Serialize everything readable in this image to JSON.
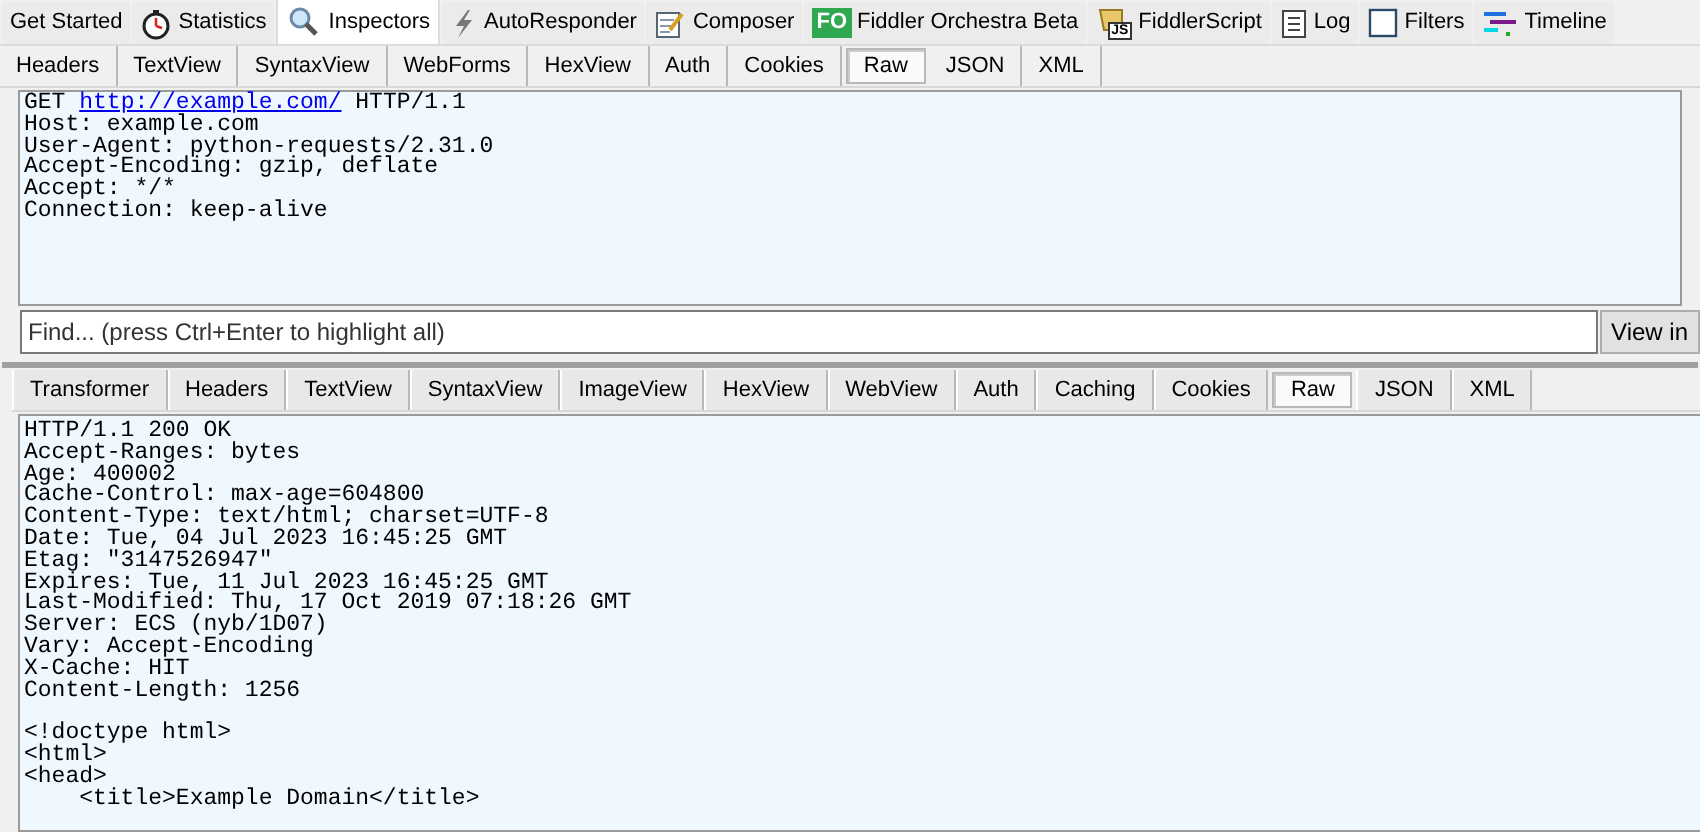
{
  "main_tabs": [
    {
      "kind": "plain",
      "label": "Get Started",
      "selected": false
    },
    {
      "kind": "stopwatch",
      "label": "Statistics",
      "selected": false
    },
    {
      "kind": "magnifier",
      "label": "Inspectors",
      "selected": true
    },
    {
      "kind": "lightning",
      "label": "AutoResponder",
      "selected": false
    },
    {
      "kind": "notepad",
      "label": "Composer",
      "selected": false
    },
    {
      "kind": "badge",
      "badge": "FO",
      "label": "Fiddler Orchestra Beta",
      "selected": false
    },
    {
      "kind": "scroll",
      "badge": "JS",
      "label": "FiddlerScript",
      "selected": false
    },
    {
      "kind": "document",
      "label": "Log",
      "selected": false
    },
    {
      "kind": "checkbox",
      "label": "Filters",
      "selected": false
    },
    {
      "kind": "timeline",
      "label": "Timeline",
      "selected": false
    }
  ],
  "request": {
    "tabs": [
      {
        "label": "Headers",
        "selected": false
      },
      {
        "label": "TextView",
        "selected": false
      },
      {
        "label": "SyntaxView",
        "selected": false
      },
      {
        "label": "WebForms",
        "selected": false
      },
      {
        "label": "HexView",
        "selected": false
      },
      {
        "label": "Auth",
        "selected": false
      },
      {
        "label": "Cookies",
        "selected": false
      },
      {
        "label": "Raw",
        "selected": true
      },
      {
        "label": "JSON",
        "selected": false
      },
      {
        "label": "XML",
        "selected": false
      }
    ],
    "request_line": {
      "method": "GET",
      "url": "http://example.com/",
      "version": "HTTP/1.1"
    },
    "headers": [
      "Host: example.com",
      "User-Agent: python-requests/2.31.0",
      "Accept-Encoding: gzip, deflate",
      "Accept: */*",
      "Connection: keep-alive"
    ],
    "find": {
      "placeholder": "Find... (press Ctrl+Enter to highlight all)"
    },
    "view_button": "View in"
  },
  "response": {
    "tabs": [
      {
        "label": "Transformer",
        "selected": false
      },
      {
        "label": "Headers",
        "selected": false
      },
      {
        "label": "TextView",
        "selected": false
      },
      {
        "label": "SyntaxView",
        "selected": false
      },
      {
        "label": "ImageView",
        "selected": false
      },
      {
        "label": "HexView",
        "selected": false
      },
      {
        "label": "WebView",
        "selected": false
      },
      {
        "label": "Auth",
        "selected": false
      },
      {
        "label": "Caching",
        "selected": false
      },
      {
        "label": "Cookies",
        "selected": false
      },
      {
        "label": "Raw",
        "selected": true
      },
      {
        "label": "JSON",
        "selected": false
      },
      {
        "label": "XML",
        "selected": false
      }
    ],
    "headers": [
      "HTTP/1.1 200 OK",
      "Accept-Ranges: bytes",
      "Age: 400002",
      "Cache-Control: max-age=604800",
      "Content-Type: text/html; charset=UTF-8",
      "Date: Tue, 04 Jul 2023 16:45:25 GMT",
      "Etag: \"3147526947\"",
      "Expires: Tue, 11 Jul 2023 16:45:25 GMT",
      "Last-Modified: Thu, 17 Oct 2019 07:18:26 GMT",
      "Server: ECS (nyb/1D07)",
      "Vary: Accept-Encoding",
      "X-Cache: HIT",
      "Content-Length: 1256"
    ],
    "body": [
      "<!doctype html>",
      "<html>",
      "<head>",
      "    <title>Example Domain</title>"
    ]
  }
}
